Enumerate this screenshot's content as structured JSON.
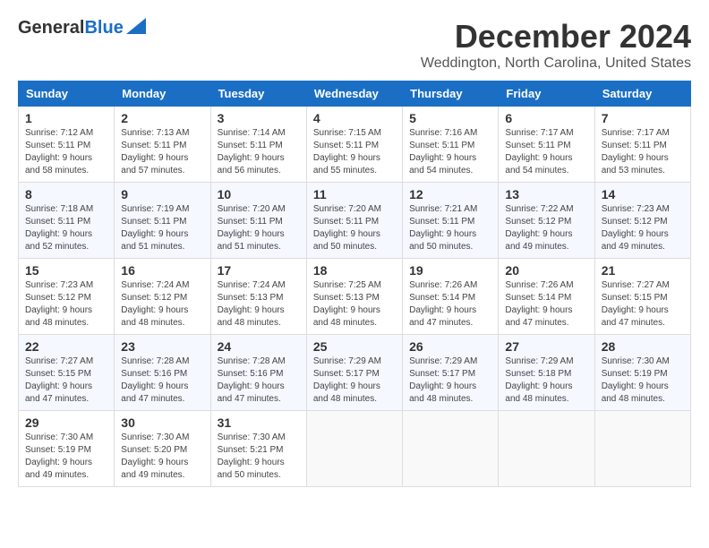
{
  "header": {
    "logo_general": "General",
    "logo_blue": "Blue",
    "month_title": "December 2024",
    "location": "Weddington, North Carolina, United States"
  },
  "days_of_week": [
    "Sunday",
    "Monday",
    "Tuesday",
    "Wednesday",
    "Thursday",
    "Friday",
    "Saturday"
  ],
  "weeks": [
    [
      {
        "day": "1",
        "info": "Sunrise: 7:12 AM\nSunset: 5:11 PM\nDaylight: 9 hours\nand 58 minutes."
      },
      {
        "day": "2",
        "info": "Sunrise: 7:13 AM\nSunset: 5:11 PM\nDaylight: 9 hours\nand 57 minutes."
      },
      {
        "day": "3",
        "info": "Sunrise: 7:14 AM\nSunset: 5:11 PM\nDaylight: 9 hours\nand 56 minutes."
      },
      {
        "day": "4",
        "info": "Sunrise: 7:15 AM\nSunset: 5:11 PM\nDaylight: 9 hours\nand 55 minutes."
      },
      {
        "day": "5",
        "info": "Sunrise: 7:16 AM\nSunset: 5:11 PM\nDaylight: 9 hours\nand 54 minutes."
      },
      {
        "day": "6",
        "info": "Sunrise: 7:17 AM\nSunset: 5:11 PM\nDaylight: 9 hours\nand 54 minutes."
      },
      {
        "day": "7",
        "info": "Sunrise: 7:17 AM\nSunset: 5:11 PM\nDaylight: 9 hours\nand 53 minutes."
      }
    ],
    [
      {
        "day": "8",
        "info": "Sunrise: 7:18 AM\nSunset: 5:11 PM\nDaylight: 9 hours\nand 52 minutes."
      },
      {
        "day": "9",
        "info": "Sunrise: 7:19 AM\nSunset: 5:11 PM\nDaylight: 9 hours\nand 51 minutes."
      },
      {
        "day": "10",
        "info": "Sunrise: 7:20 AM\nSunset: 5:11 PM\nDaylight: 9 hours\nand 51 minutes."
      },
      {
        "day": "11",
        "info": "Sunrise: 7:20 AM\nSunset: 5:11 PM\nDaylight: 9 hours\nand 50 minutes."
      },
      {
        "day": "12",
        "info": "Sunrise: 7:21 AM\nSunset: 5:11 PM\nDaylight: 9 hours\nand 50 minutes."
      },
      {
        "day": "13",
        "info": "Sunrise: 7:22 AM\nSunset: 5:12 PM\nDaylight: 9 hours\nand 49 minutes."
      },
      {
        "day": "14",
        "info": "Sunrise: 7:23 AM\nSunset: 5:12 PM\nDaylight: 9 hours\nand 49 minutes."
      }
    ],
    [
      {
        "day": "15",
        "info": "Sunrise: 7:23 AM\nSunset: 5:12 PM\nDaylight: 9 hours\nand 48 minutes."
      },
      {
        "day": "16",
        "info": "Sunrise: 7:24 AM\nSunset: 5:12 PM\nDaylight: 9 hours\nand 48 minutes."
      },
      {
        "day": "17",
        "info": "Sunrise: 7:24 AM\nSunset: 5:13 PM\nDaylight: 9 hours\nand 48 minutes."
      },
      {
        "day": "18",
        "info": "Sunrise: 7:25 AM\nSunset: 5:13 PM\nDaylight: 9 hours\nand 48 minutes."
      },
      {
        "day": "19",
        "info": "Sunrise: 7:26 AM\nSunset: 5:14 PM\nDaylight: 9 hours\nand 47 minutes."
      },
      {
        "day": "20",
        "info": "Sunrise: 7:26 AM\nSunset: 5:14 PM\nDaylight: 9 hours\nand 47 minutes."
      },
      {
        "day": "21",
        "info": "Sunrise: 7:27 AM\nSunset: 5:15 PM\nDaylight: 9 hours\nand 47 minutes."
      }
    ],
    [
      {
        "day": "22",
        "info": "Sunrise: 7:27 AM\nSunset: 5:15 PM\nDaylight: 9 hours\nand 47 minutes."
      },
      {
        "day": "23",
        "info": "Sunrise: 7:28 AM\nSunset: 5:16 PM\nDaylight: 9 hours\nand 47 minutes."
      },
      {
        "day": "24",
        "info": "Sunrise: 7:28 AM\nSunset: 5:16 PM\nDaylight: 9 hours\nand 47 minutes."
      },
      {
        "day": "25",
        "info": "Sunrise: 7:29 AM\nSunset: 5:17 PM\nDaylight: 9 hours\nand 48 minutes."
      },
      {
        "day": "26",
        "info": "Sunrise: 7:29 AM\nSunset: 5:17 PM\nDaylight: 9 hours\nand 48 minutes."
      },
      {
        "day": "27",
        "info": "Sunrise: 7:29 AM\nSunset: 5:18 PM\nDaylight: 9 hours\nand 48 minutes."
      },
      {
        "day": "28",
        "info": "Sunrise: 7:30 AM\nSunset: 5:19 PM\nDaylight: 9 hours\nand 48 minutes."
      }
    ],
    [
      {
        "day": "29",
        "info": "Sunrise: 7:30 AM\nSunset: 5:19 PM\nDaylight: 9 hours\nand 49 minutes."
      },
      {
        "day": "30",
        "info": "Sunrise: 7:30 AM\nSunset: 5:20 PM\nDaylight: 9 hours\nand 49 minutes."
      },
      {
        "day": "31",
        "info": "Sunrise: 7:30 AM\nSunset: 5:21 PM\nDaylight: 9 hours\nand 50 minutes."
      },
      {
        "day": "",
        "info": ""
      },
      {
        "day": "",
        "info": ""
      },
      {
        "day": "",
        "info": ""
      },
      {
        "day": "",
        "info": ""
      }
    ]
  ]
}
